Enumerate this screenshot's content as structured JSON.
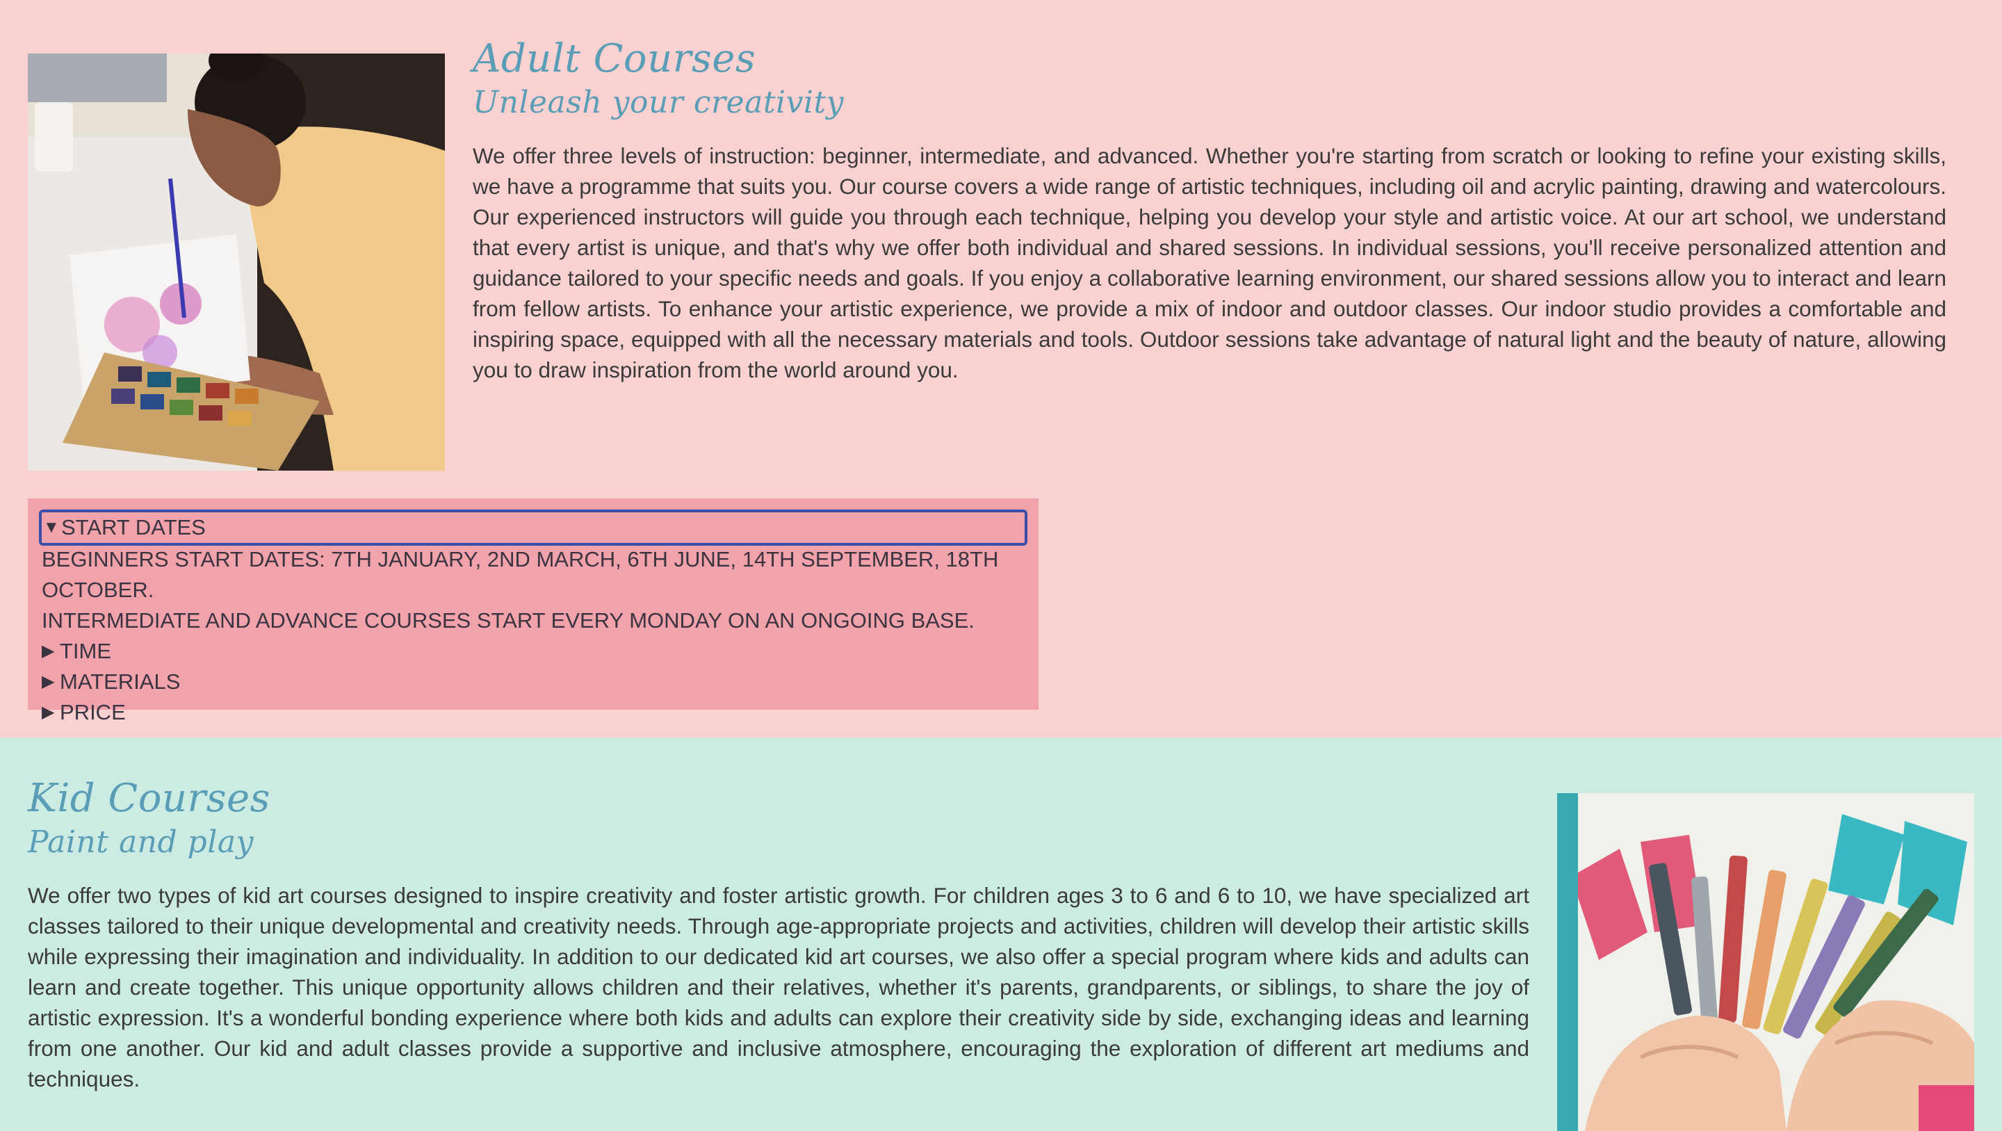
{
  "adult": {
    "title": "Adult Courses",
    "subtitle": "Unleash your creativity",
    "paragraph": "We offer three levels of instruction: beginner, intermediate, and advanced. Whether you're starting from scratch or looking to refine your existing skills, we have a programme that suits you. Our course covers a wide range of artistic techniques, including oil and acrylic painting, drawing and watercolours. Our experienced instructors will guide you through each technique, helping you develop your style and artistic voice. At our art school, we understand that every artist is unique, and that's why we offer both individual and shared sessions. In individual sessions, you'll receive personalized attention and guidance tailored to your specific needs and goals. If you enjoy a collaborative learning environment, our shared sessions allow you to interact and learn from fellow artists. To enhance your artistic experience, we provide a mix of indoor and outdoor classes. Our indoor studio provides a comfortable and inspiring space, equipped with all the necessary materials and tools. Outdoor sessions take advantage of natural light and the beauty of nature, allowing you to draw inspiration from the world around you.",
    "details": {
      "start_dates": {
        "label": "Start dates",
        "open_icon": "▼",
        "lines": [
          "Beginners start dates: 7th January, 2nd March, 6th June, 14th September, 18th October.",
          "Intermediate and advance courses start every Monday on an ongoing base."
        ]
      },
      "closed_icon": "▶",
      "time_label": "Time",
      "materials_label": "Materials",
      "price_label": "Price"
    }
  },
  "kid": {
    "title": "Kid Courses",
    "subtitle": "Paint and play",
    "paragraph": "We offer two types of kid art courses designed to inspire creativity and foster artistic growth. For children ages 3 to 6 and 6 to 10, we have specialized art classes tailored to their unique developmental and creativity needs. Through age-appropriate projects and activities, children will develop their artistic skills while expressing their imagination and individuality. In addition to our dedicated kid art courses, we also offer a special program where kids and adults can learn and create together. This unique opportunity allows children and their relatives, whether it's parents, grandparents, or siblings, to share the joy of artistic expression. It's a wonderful bonding experience where both kids and adults can explore their creativity side by side, exchanging ideas and learning from one another. Our kid and adult classes provide a supportive and inclusive atmosphere, encouraging the exploration of different art mediums and techniques."
  },
  "colors": {
    "adult_bg": "#f9d1d1",
    "kid_bg": "#cbebe3",
    "heading": "#5a9db6",
    "details_bg": "#f2a2ab",
    "focus_ring": "#3b4fa8"
  },
  "images": {
    "adult": "painting-photo",
    "kid": "crayons-photo"
  }
}
